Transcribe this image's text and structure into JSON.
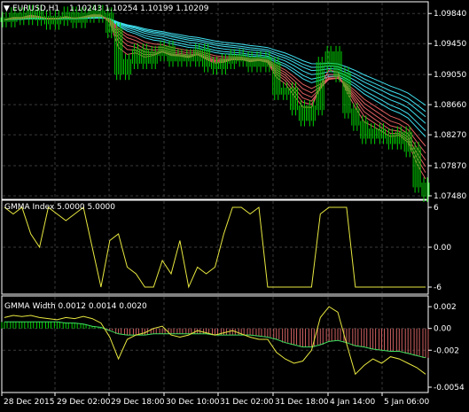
{
  "colors": {
    "background": "#000000",
    "frame": "#ffffff",
    "grid": "#3a3a3a",
    "text": "#ffffff",
    "bull": "#00d000",
    "bear": "#00d000",
    "short_ema": "#e06060",
    "long_ema": "#40e0f0",
    "indicator_line": "#e8e840",
    "histogram": "#d06060",
    "signal_line": "#40e060"
  },
  "main": {
    "symbol_label": "EURUSD,H1",
    "ohlc_label": "1.10243 1.10254 1.10199 1.10209",
    "arrow_icon": "▼",
    "price_ticks": [
      "1.09840",
      "1.09450",
      "1.09050",
      "1.08660",
      "1.08270",
      "1.07870",
      "1.07480"
    ]
  },
  "gmma_index": {
    "title": "GMMA Index 5.0000 5.0000",
    "ticks": [
      "6",
      "0.00",
      "-6"
    ]
  },
  "gmma_width": {
    "title": "GMMA Width 0.0012 0.0014 0.0020",
    "ticks": [
      "0.002",
      "0.00",
      "-0.002",
      "-0.0054"
    ]
  },
  "time_labels": [
    "28 Dec 2015",
    "29 Dec 02:00",
    "29 Dec 18:00",
    "30 Dec 10:00",
    "31 Dec 02:00",
    "31 Dec 18:00",
    "4 Jan 14:00",
    "5 Jan 06:00"
  ],
  "chart_data": {
    "type": "line",
    "title": "EURUSD,H1",
    "panes": [
      {
        "name": "price",
        "series": [
          {
            "name": "close",
            "x": [
              0,
              10,
              20,
              30,
              40,
              50,
              60,
              70,
              80,
              90,
              100,
              110,
              120,
              130,
              140,
              150,
              160,
              170,
              180,
              190,
              200,
              210,
              220,
              230,
              240,
              250,
              260,
              270,
              280,
              290,
              300,
              310,
              320,
              330,
              340,
              350,
              360,
              370,
              380,
              390,
              400,
              410,
              420,
              430,
              440,
              450,
              460,
              470,
              480
            ],
            "values": [
              1.0976,
              1.0982,
              1.0979,
              1.0985,
              1.0978,
              1.0973,
              1.0978,
              1.0983,
              1.0975,
              1.0982,
              1.0985,
              1.0982,
              1.0962,
              1.0908,
              1.0922,
              1.0935,
              1.0922,
              1.0932,
              1.0939,
              1.0925,
              1.0928,
              1.0925,
              1.0935,
              1.0918,
              1.0915,
              1.0922,
              1.0928,
              1.0925,
              1.0918,
              1.0925,
              1.0918,
              1.0882,
              1.0885,
              1.0862,
              1.0848,
              1.0862,
              1.0918,
              1.0932,
              1.0905,
              1.0858,
              1.0842,
              1.0825,
              1.0832,
              1.0825,
              1.0818,
              1.0828,
              1.0808,
              1.0762,
              1.075
            ]
          }
        ],
        "ylim": [
          1.0748,
          1.099
        ]
      },
      {
        "name": "GMMA Index",
        "ylim": [
          -6,
          6
        ],
        "x": [
          0,
          10,
          20,
          30,
          40,
          50,
          60,
          70,
          80,
          90,
          100,
          110,
          120,
          130,
          140,
          150,
          160,
          170,
          180,
          190,
          200,
          210,
          220,
          230,
          240,
          250,
          260,
          270,
          280,
          290,
          300,
          310,
          320,
          330,
          340,
          350,
          360,
          370,
          380,
          390,
          400,
          410,
          420,
          430,
          440,
          450,
          460,
          470,
          480
        ],
        "values": [
          6,
          5,
          6,
          2,
          0,
          6,
          5,
          4,
          5,
          6,
          0,
          -6,
          1,
          2,
          -3,
          -4,
          -6,
          -6,
          -2,
          -4,
          1,
          -6,
          -3,
          -4,
          -3,
          2,
          6,
          6,
          5,
          6,
          -6,
          -6,
          -6,
          -6,
          -6,
          -6,
          5,
          6,
          6,
          6,
          -6,
          -6,
          -6,
          -6,
          -6,
          -6,
          -6,
          -6,
          -6
        ]
      },
      {
        "name": "GMMA Width",
        "ylim": [
          -0.0054,
          0.0025
        ],
        "x": [
          0,
          10,
          20,
          30,
          40,
          50,
          60,
          70,
          80,
          90,
          100,
          110,
          120,
          130,
          140,
          150,
          160,
          170,
          180,
          190,
          200,
          210,
          220,
          230,
          240,
          250,
          260,
          270,
          280,
          290,
          300,
          310,
          320,
          330,
          340,
          350,
          360,
          370,
          380,
          390,
          400,
          410,
          420,
          430,
          440,
          450,
          460,
          470,
          480
        ],
        "series": [
          {
            "name": "width",
            "values": [
              0.001,
              0.0012,
              0.0011,
              0.0012,
              0.001,
              0.0009,
              0.0008,
              0.001,
              0.0009,
              0.0011,
              0.0009,
              0.0005,
              -0.0008,
              -0.0028,
              -0.001,
              -0.0006,
              -0.0004,
              0.0,
              0.0002,
              -0.0006,
              -0.0008,
              -0.0006,
              -0.0002,
              -0.0004,
              -0.0006,
              -0.0004,
              -0.0002,
              -0.0005,
              -0.0008,
              -0.001,
              -0.001,
              -0.0022,
              -0.0028,
              -0.0032,
              -0.003,
              -0.002,
              0.001,
              0.002,
              0.0015,
              -0.0014,
              -0.0042,
              -0.0034,
              -0.0028,
              -0.0032,
              -0.0026,
              -0.0028,
              -0.0032,
              -0.0036,
              -0.0042
            ]
          },
          {
            "name": "signal",
            "values": [
              0.0006,
              0.0006,
              0.0006,
              0.0006,
              0.0006,
              0.0006,
              0.0006,
              0.0005,
              0.0005,
              0.0004,
              0.0002,
              0.0001,
              -0.0002,
              -0.0005,
              -0.0006,
              -0.0006,
              -0.0006,
              -0.0005,
              -0.0005,
              -0.0005,
              -0.0005,
              -0.0005,
              -0.0005,
              -0.0005,
              -0.0006,
              -0.0006,
              -0.0006,
              -0.0006,
              -0.0006,
              -0.0007,
              -0.0008,
              -0.001,
              -0.0013,
              -0.0015,
              -0.0017,
              -0.0017,
              -0.0015,
              -0.0012,
              -0.0011,
              -0.0013,
              -0.0016,
              -0.0017,
              -0.0019,
              -0.002,
              -0.0021,
              -0.0021,
              -0.0023,
              -0.0025,
              -0.0027
            ]
          }
        ]
      }
    ]
  }
}
